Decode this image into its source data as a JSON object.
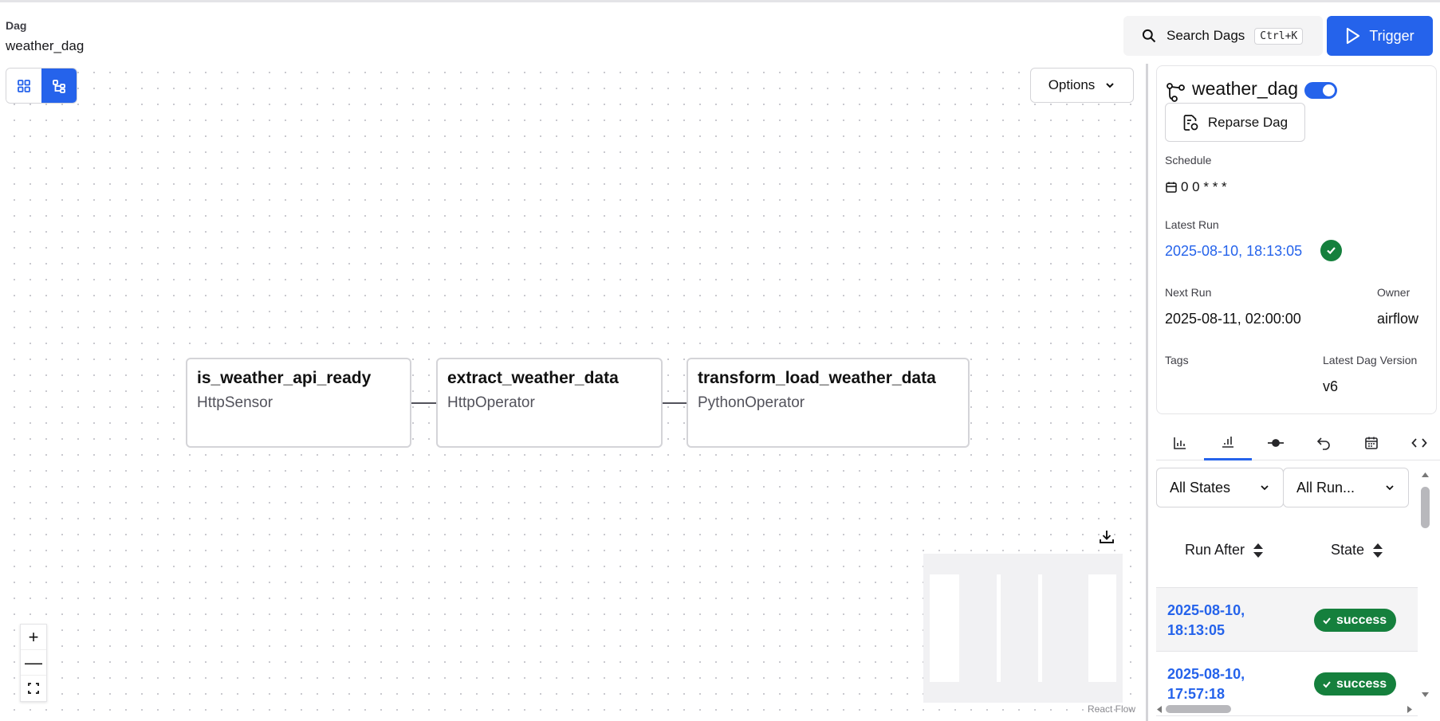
{
  "header": {
    "breadcrumb": "Dag",
    "dag_name": "weather_dag",
    "search_label": "Search Dags",
    "search_shortcut": "Ctrl+K",
    "trigger_label": "Trigger"
  },
  "graph": {
    "options_label": "Options",
    "nodes": [
      {
        "task": "is_weather_api_ready",
        "operator": "HttpSensor"
      },
      {
        "task": "extract_weather_data",
        "operator": "HttpOperator"
      },
      {
        "task": "transform_load_weather_data",
        "operator": "PythonOperator"
      }
    ],
    "attribution": "React Flow",
    "zoom_controls": [
      "+",
      "—",
      "fit-view-icon"
    ]
  },
  "details": {
    "dag_name": "weather_dag",
    "paused": false,
    "reparse_label": "Reparse Dag",
    "schedule_label": "Schedule",
    "schedule_value": "0 0 * * *",
    "latest_run_label": "Latest Run",
    "latest_run_value": "2025-08-10, 18:13:05",
    "next_run_label": "Next Run",
    "next_run_value": "2025-08-11, 02:00:00",
    "owner_label": "Owner",
    "owner_value": "airflow",
    "tags_label": "Tags",
    "version_label": "Latest Dag Version",
    "version_value": "v6"
  },
  "tabs": [
    "bar-chart-icon",
    "chart-column-icon",
    "commit-icon",
    "undo-icon",
    "calendar-icon",
    "code-icon"
  ],
  "filters": {
    "state": "All States",
    "run_type": "All Run..."
  },
  "runs_table": {
    "columns": [
      "Run After",
      "State"
    ],
    "rows": [
      {
        "run_after": "2025-08-10, 18:13:05",
        "state": "success"
      },
      {
        "run_after": "2025-08-10, 17:57:18",
        "state": "success"
      }
    ]
  },
  "colors": {
    "accent": "#2563eb",
    "success": "#15803d"
  }
}
